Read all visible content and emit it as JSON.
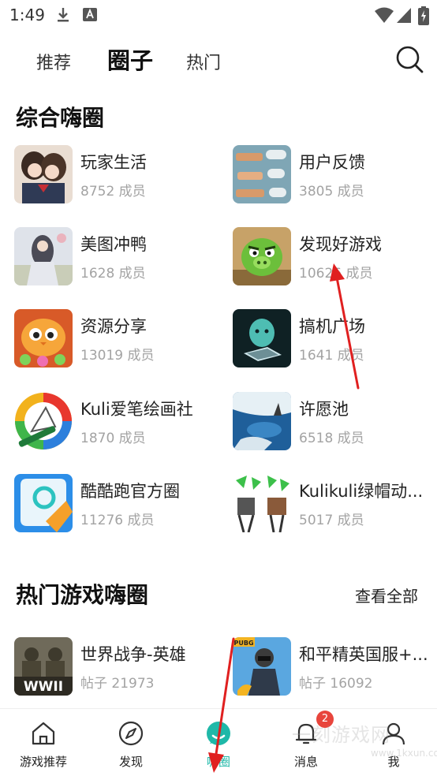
{
  "status_bar": {
    "time": "1:49"
  },
  "top_tabs": [
    {
      "label": "推荐"
    },
    {
      "label": "圈子"
    },
    {
      "label": "热门"
    }
  ],
  "sections": {
    "general": {
      "title": "综合嗨圈",
      "items": [
        {
          "name": "玩家生活",
          "count": "8752 成员"
        },
        {
          "name": "用户反馈",
          "count": "3805 成员"
        },
        {
          "name": "美图冲鸭",
          "count": "1628 成员"
        },
        {
          "name": "发现好游戏",
          "count": "10626 成员"
        },
        {
          "name": "资源分享",
          "count": "13019 成员"
        },
        {
          "name": "搞机广场",
          "count": "1641 成员"
        },
        {
          "name": "Kuli爱笔绘画社",
          "count": "1870 成员"
        },
        {
          "name": "许愿池",
          "count": "6518 成员"
        },
        {
          "name": "酷酷跑官方圈",
          "count": "11276 成员"
        },
        {
          "name": "Kulikuli绿帽动...",
          "count": "5017 成员"
        }
      ]
    },
    "hot_games": {
      "title": "热门游戏嗨圈",
      "view_all": "查看全部",
      "items": [
        {
          "name": "世界战争-英雄",
          "posts": "帖子  21973",
          "thumb_text": "WWII"
        },
        {
          "name": "和平精英国服+...",
          "posts": "帖子  16092",
          "thumb_text": "PUBG"
        }
      ]
    }
  },
  "bottom_nav": [
    {
      "label": "游戏推荐"
    },
    {
      "label": "发现"
    },
    {
      "label": "嗨圈"
    },
    {
      "label": "消息",
      "badge": "2"
    },
    {
      "label": "我"
    }
  ],
  "watermark": {
    "main": "一刻游戏网",
    "sub": "www.1kxun.com"
  },
  "colors": {
    "accent": "#1fb8a8",
    "badge": "#e8453c",
    "arrow": "#e02020",
    "muted": "#a3a3a3"
  }
}
